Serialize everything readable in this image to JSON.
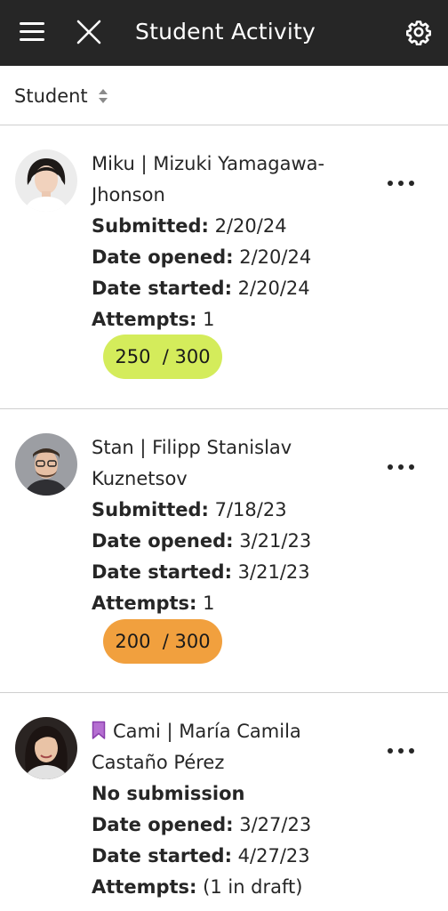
{
  "header": {
    "title": "Student Activity",
    "menu_icon": "hamburger-menu-icon",
    "close_icon": "close-icon",
    "settings_icon": "gear-icon",
    "background": "#262626"
  },
  "sort": {
    "label": "Student",
    "icon": "sort-arrows-icon"
  },
  "labels": {
    "submitted": "Submitted:",
    "date_opened": "Date opened:",
    "date_started": "Date started:",
    "attempts": "Attempts:",
    "no_submission": "No submission"
  },
  "students": [
    {
      "name": "Miku | Mizuki Yamagawa-Jhonson",
      "submitted": "2/20/24",
      "date_opened": "2/20/24",
      "date_started": "2/20/24",
      "attempts": "1",
      "grade_score": "250",
      "grade_total": "/ 300",
      "grade_color": "#d4ec5b"
    },
    {
      "name": "Stan | Filipp Stanislav Kuznetsov",
      "submitted": "7/18/23",
      "date_opened": "3/21/23",
      "date_started": "3/21/23",
      "attempts": "1",
      "grade_score": "200",
      "grade_total": "/ 300",
      "grade_color": "#f1a03e"
    },
    {
      "name": "Cami | María Camila Castaño Pérez",
      "flag_icon": "bookmark-flag-icon",
      "flag_color": "#b56fd1",
      "status": "No submission",
      "date_opened": "3/27/23",
      "date_started": "4/27/23",
      "attempts": "(1 in draft)"
    }
  ]
}
